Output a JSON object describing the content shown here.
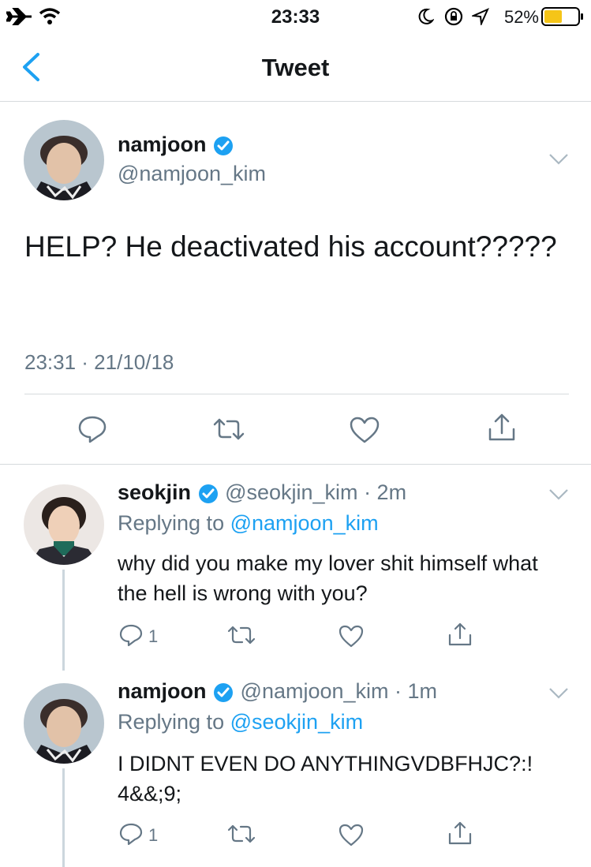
{
  "status_bar": {
    "time": "23:33",
    "battery_percent": "52%"
  },
  "nav": {
    "title": "Tweet"
  },
  "main_tweet": {
    "name": "namjoon",
    "handle": "@namjoon_kim",
    "text": "HELP? He deactivated his account?????",
    "timestamp": "23:31 · 21/10/18"
  },
  "replies": [
    {
      "name": "seokjin",
      "handle": "@seokjin_kim",
      "age": "· 2m",
      "replying_prefix": "Replying to",
      "replying_to": "@namjoon_kim",
      "text": "why did you make my lover shit himself what the hell is wrong with you?",
      "reply_count": "1"
    },
    {
      "name": "namjoon",
      "handle": "@namjoon_kim",
      "age": "· 1m",
      "replying_prefix": "Replying to",
      "replying_to": "@seokjin_kim",
      "text": "I DIDNT EVEN DO ANYTHINGVDBFHJC?:! 4&&;9;",
      "reply_count": "1"
    }
  ],
  "colors": {
    "accent": "#1da1f2",
    "muted": "#657786",
    "divider": "#d6dadd",
    "battery": "#f5c518"
  },
  "icons": [
    "airplane-icon",
    "wifi-icon",
    "moon-icon",
    "rotation-lock-icon",
    "location-icon",
    "battery-icon",
    "back-chevron-icon",
    "verified-badge-icon",
    "chevron-down-icon",
    "reply-icon",
    "retweet-icon",
    "like-icon",
    "share-icon"
  ]
}
